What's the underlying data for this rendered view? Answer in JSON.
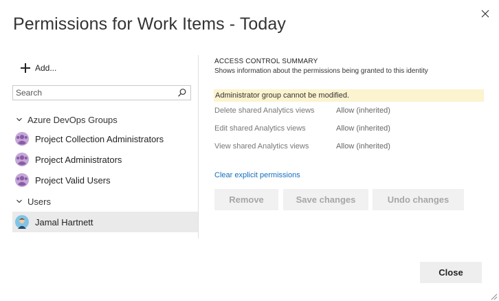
{
  "dialog": {
    "title": "Permissions for Work Items - Today",
    "close_icon": "close-icon"
  },
  "identities": {
    "add_label": "Add...",
    "search_placeholder": "Search",
    "groups": [
      {
        "label": "Azure DevOps Groups",
        "items": [
          {
            "label": "Project Collection Administrators",
            "icon": "group-icon"
          },
          {
            "label": "Project Administrators",
            "icon": "group-icon"
          },
          {
            "label": "Project Valid Users",
            "icon": "group-icon"
          }
        ]
      },
      {
        "label": "Users",
        "items": [
          {
            "label": "Jamal Hartnett",
            "icon": "user-avatar",
            "selected": true
          }
        ]
      }
    ]
  },
  "summary": {
    "title": "ACCESS CONTROL SUMMARY",
    "subtitle": "Shows information about the permissions being granted to this identity",
    "warning": "Administrator group cannot be modified.",
    "permissions": [
      {
        "name": "Delete shared Analytics views",
        "value": "Allow (inherited)"
      },
      {
        "name": "Edit shared Analytics views",
        "value": "Allow (inherited)"
      },
      {
        "name": "View shared Analytics views",
        "value": "Allow (inherited)"
      }
    ],
    "clear_link": "Clear explicit permissions"
  },
  "actions": {
    "remove": "Remove",
    "save": "Save changes",
    "undo": "Undo changes",
    "close": "Close"
  },
  "colors": {
    "warning_bg": "#fcf3cf",
    "link": "#106ebe",
    "group_icon": "#8b5ba8",
    "selected_row": "#eaeaea"
  }
}
